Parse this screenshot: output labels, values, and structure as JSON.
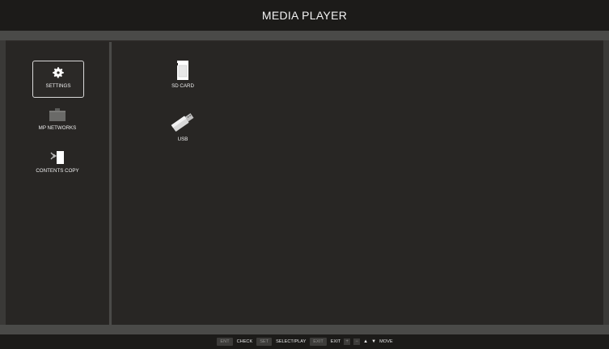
{
  "header": {
    "title": "MEDIA PLAYER"
  },
  "sidebar": {
    "items": [
      {
        "label": "SETTINGS",
        "icon": "gear-icon",
        "selected": true
      },
      {
        "label": "MP NETWORKS",
        "icon": "network-folder-icon",
        "selected": false
      },
      {
        "label": "CONTENTS COPY",
        "icon": "copy-icon",
        "selected": false
      }
    ]
  },
  "main": {
    "items": [
      {
        "label": "SD CARD",
        "icon": "sd-card-icon"
      },
      {
        "label": "USB",
        "icon": "usb-icon"
      }
    ]
  },
  "footer": {
    "ent_key": "ENT",
    "ent_action": "CHECK",
    "set_key": "SET",
    "set_action": "SELECT/PLAY",
    "exit_key": "EXIT",
    "exit_action": "EXIT",
    "plus_key": "+",
    "minus_key": "−",
    "move_action": "MOVE"
  },
  "colors": {
    "background": "#2b2826",
    "topbar": "#1c1b19",
    "strip": "#4a4a48"
  }
}
